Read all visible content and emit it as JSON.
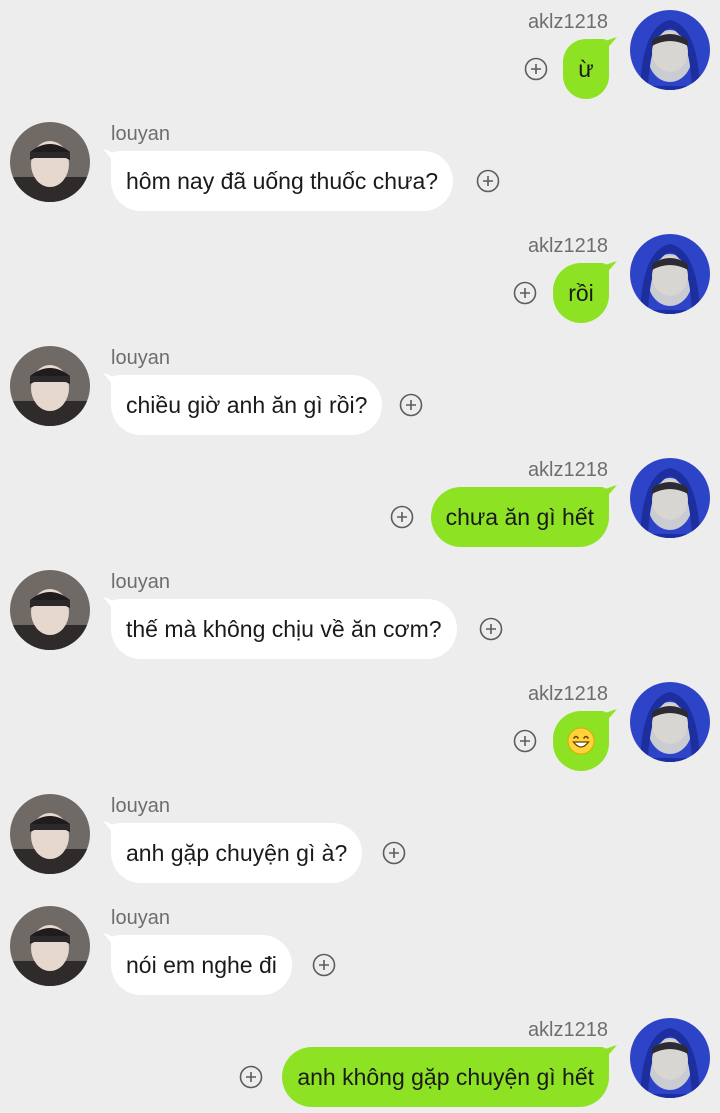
{
  "users": {
    "me": {
      "name": "aklz1218"
    },
    "other": {
      "name": "louyan"
    }
  },
  "messages": [
    {
      "side": "right",
      "name": "aklz1218",
      "text": "ừ"
    },
    {
      "side": "left",
      "name": "louyan",
      "text": "hôm nay đã uống thuốc chưa?"
    },
    {
      "side": "right",
      "name": "aklz1218",
      "text": "rồi"
    },
    {
      "side": "left",
      "name": "louyan",
      "text": "chiều giờ anh ăn gì rồi?"
    },
    {
      "side": "right",
      "name": "aklz1218",
      "text": "chưa ăn gì hết"
    },
    {
      "side": "left",
      "name": "louyan",
      "text": "thế mà không chịu về ăn cơm?"
    },
    {
      "side": "right",
      "name": "aklz1218",
      "text": "",
      "emoji": "grinning-face-emoji"
    },
    {
      "side": "left",
      "name": "louyan",
      "text": "anh gặp chuyện gì à?"
    },
    {
      "side": "left",
      "name": "louyan",
      "text": "nói em nghe đi"
    },
    {
      "side": "right",
      "name": "aklz1218",
      "text": "anh không gặp chuyện gì hết"
    }
  ],
  "colors": {
    "background": "#ededed",
    "sent_bubble": "#8de224",
    "received_bubble": "#ffffff"
  },
  "icons": {
    "add_reaction": "plus-circle-icon"
  }
}
